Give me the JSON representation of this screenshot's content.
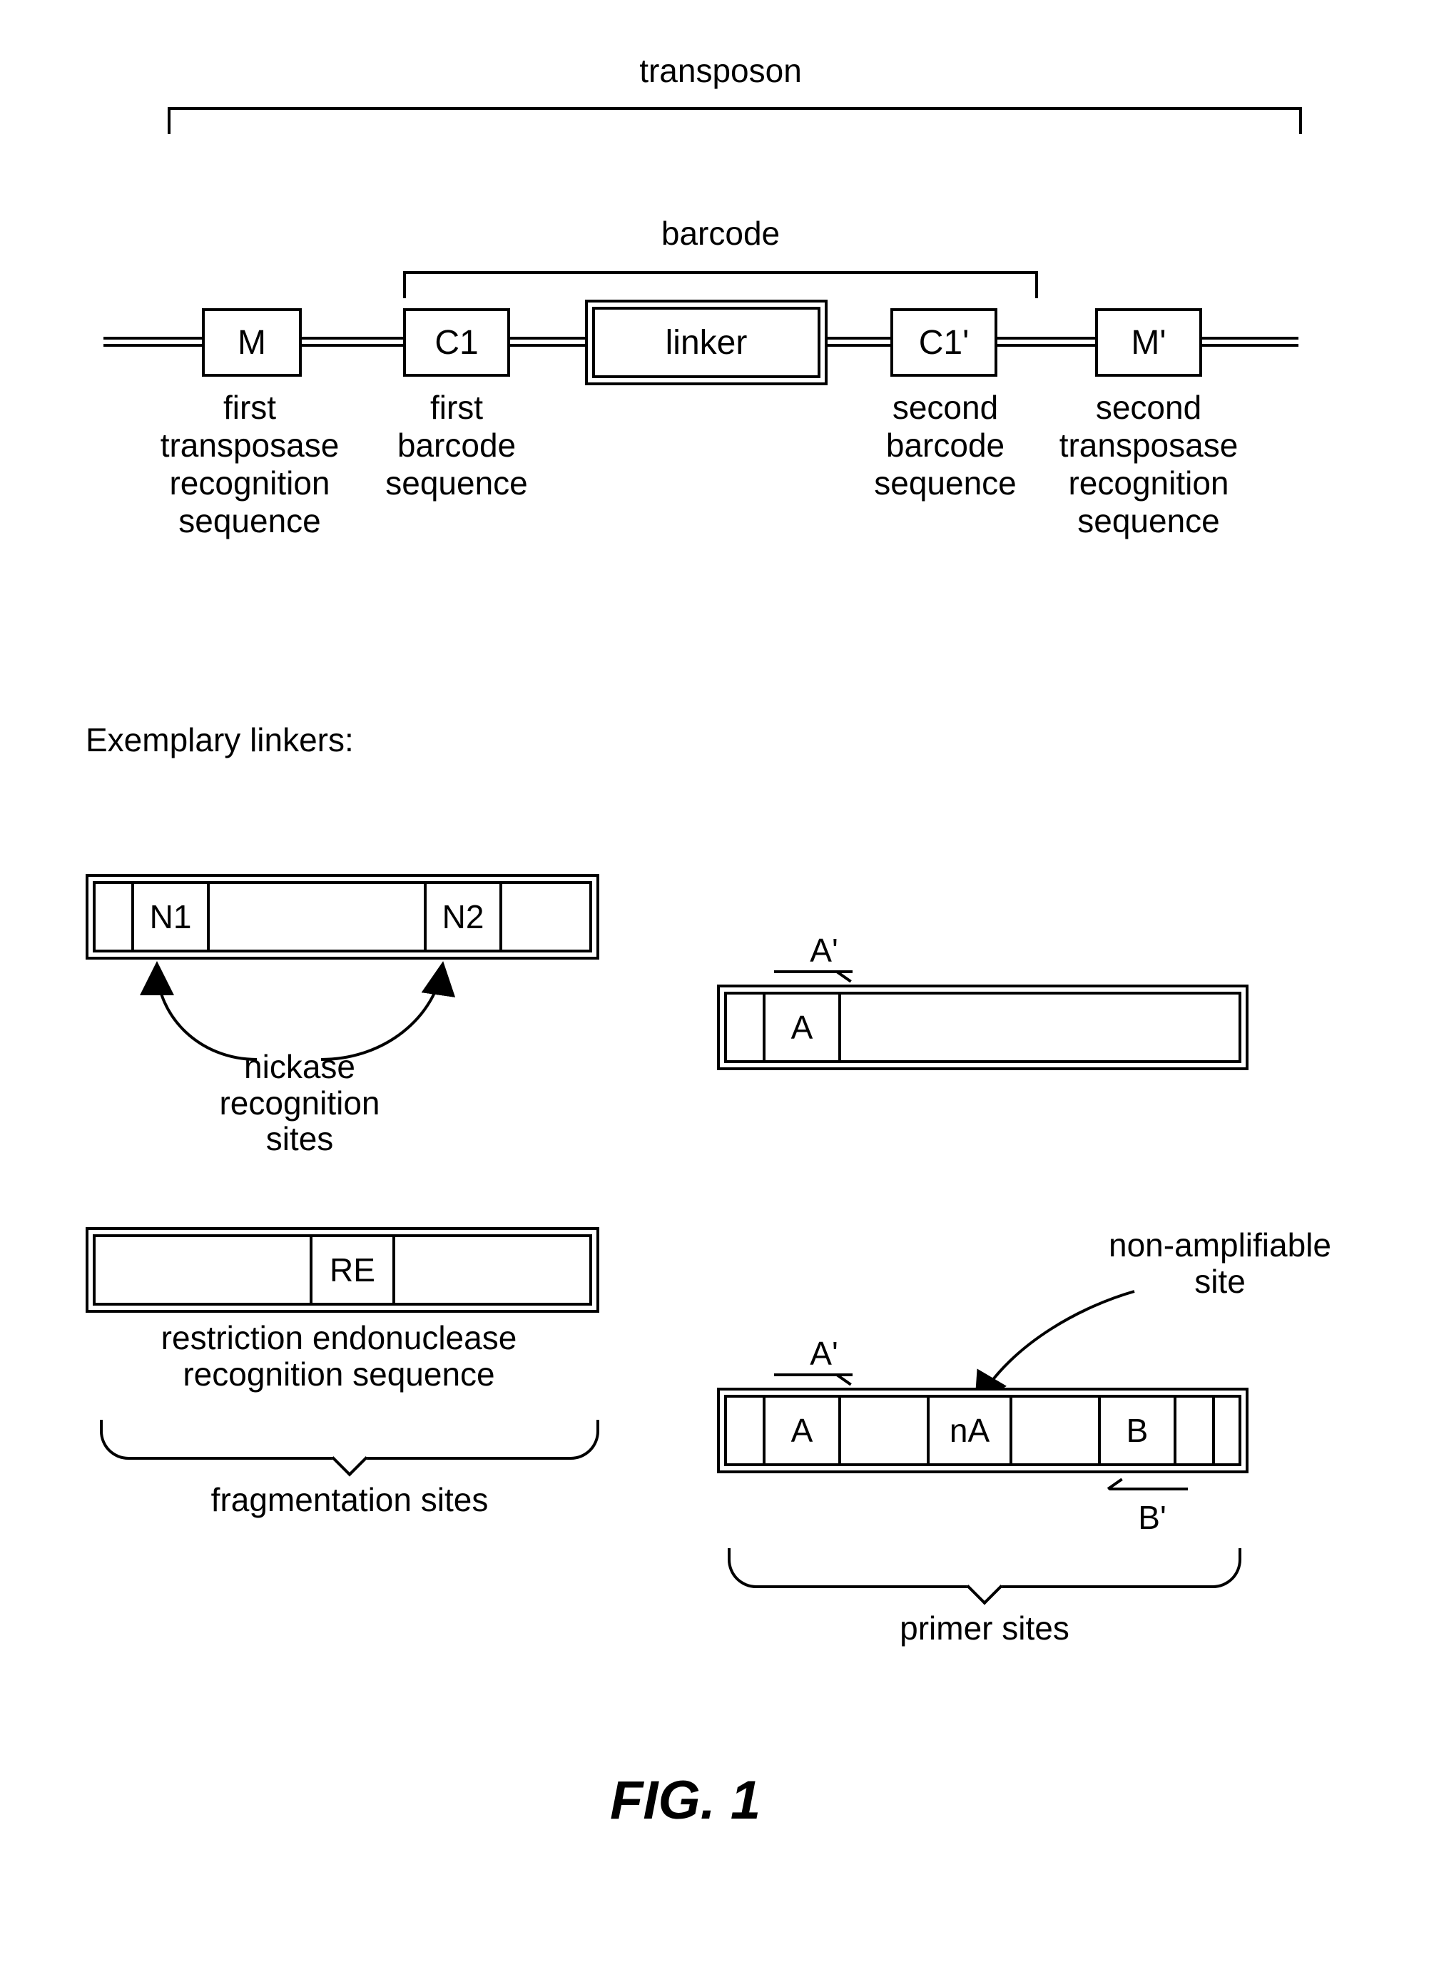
{
  "fig_title": "FIG. 1",
  "labels": {
    "transposon": "transposon",
    "barcode": "barcode",
    "first_trans": "first\ntransposase\nrecognition\nsequence",
    "first_barcode": "first\nbarcode\nsequence",
    "second_barcode": "second\nbarcode\nsequence",
    "second_trans": "second\ntransposase\nrecognition\nsequence",
    "exemplary_linkers": "Exemplary linkers:",
    "nickase": "nickase\nrecognition\nsites",
    "restriction": "restriction endonuclease\nrecognition sequence",
    "fragmentation": "fragmentation sites",
    "non_amp": "non-amplifiable\nsite",
    "primer_sites": "primer sites"
  },
  "boxes": {
    "M": "M",
    "C1": "C1",
    "linker": "linker",
    "C1p": "C1'",
    "Mp": "M'",
    "N1": "N1",
    "N2": "N2",
    "RE": "RE",
    "A": "A",
    "Ap": "A'",
    "nA": "nA",
    "B": "B",
    "Bp": "B'"
  }
}
